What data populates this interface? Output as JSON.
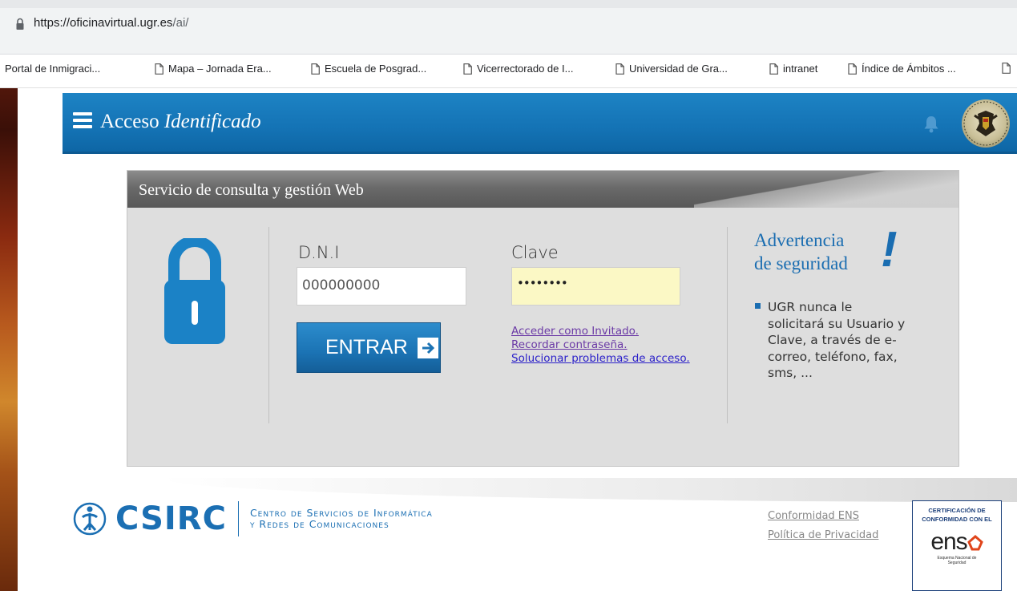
{
  "browser": {
    "url_host": "https://oficinavirtual.ugr.es",
    "url_path": "/ai/",
    "bookmarks": [
      "Portal de Inmigraci...",
      "Mapa – Jornada Era...",
      "Escuela de Posgrad...",
      "Vicerrectorado de I...",
      "Universidad de Gra...",
      "intranet",
      "Índice de Ámbitos ..."
    ]
  },
  "header": {
    "title_plain": "Acceso ",
    "title_italic": "Identificado"
  },
  "panel": {
    "title": "Servicio de consulta y gestión Web",
    "dni_label": "D.N.I",
    "dni_value": "000000000",
    "clave_label": "Clave",
    "clave_value": "••••••••",
    "entrar_label": "ENTRAR",
    "links": [
      "Acceder como Invitado.",
      "Recordar contraseña.",
      "Solucionar problemas de acceso."
    ],
    "advertencia_line1": "Advertencia",
    "advertencia_line2": "de seguridad",
    "advertencia_mark": "!",
    "advertencia_text": "UGR nunca le solicitará su Usuario y Clave, a través de e-correo, teléfono, fax, sms, ..."
  },
  "footer": {
    "logo_text": "CSIRC",
    "logo_sub1": "Centro de Servicios de Informática",
    "logo_sub2": "y Redes de Comunicaciones",
    "link_ens": "Conformidad ENS",
    "link_privacy": "Política de Privacidad",
    "badge_line1": "CERTIFICACIÓN DE",
    "badge_line2": "CONFORMIDAD CON EL",
    "badge_word": "ens",
    "badge_small1": "Esquema Nacional de",
    "badge_small2": "Seguridad"
  },
  "colors": {
    "header_blue": "#1473b5",
    "accent_blue": "#1a6db1",
    "link_blue": "#2a1fc9",
    "password_bg": "#fbf8c5"
  }
}
